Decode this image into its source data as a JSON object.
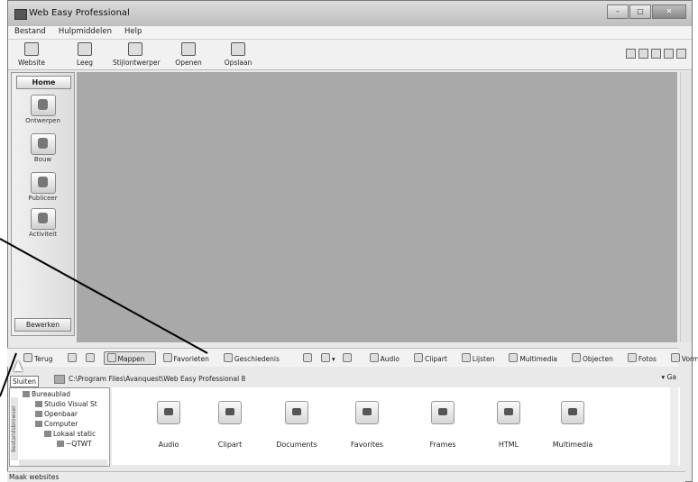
{
  "window": {
    "title": "Web Easy Professional"
  },
  "menu": [
    "Bestand",
    "Hulpmiddelen",
    "Help"
  ],
  "toolbar": [
    "Website",
    "Leeg",
    "Stijlontwerper",
    "Openen",
    "Opslaan"
  ],
  "sidebar": {
    "home": "Home",
    "items": [
      "Ontwerpen",
      "Bouw",
      "Publiceer",
      "Activiteit"
    ],
    "edit": "Bewerken"
  },
  "browser_toolbar": {
    "back": "Terug",
    "folders": "Mappen",
    "favorites": "Favorieten",
    "history": "Geschiedenis",
    "categories": [
      "Audio",
      "Clipart",
      "Lijsten",
      "Multimedia",
      "Objecten",
      "Fotos",
      "Vorm"
    ]
  },
  "tooltip": "Sluiten",
  "path": {
    "value": "C:\\Program Files\\Avanquest\\Web Easy Professional 8",
    "go": "Ga"
  },
  "tree": {
    "nodes": [
      "Bureaublad",
      "Studio Visual St",
      "Openbaar",
      "Computer",
      "Lokaal static",
      "~QTWT"
    ],
    "side_label": "Bestandsbrowser"
  },
  "files": [
    "Audio",
    "Clipart",
    "Documents",
    "Favorites",
    "Frames",
    "HTML",
    "Multimedia"
  ],
  "status": "Maak websites"
}
